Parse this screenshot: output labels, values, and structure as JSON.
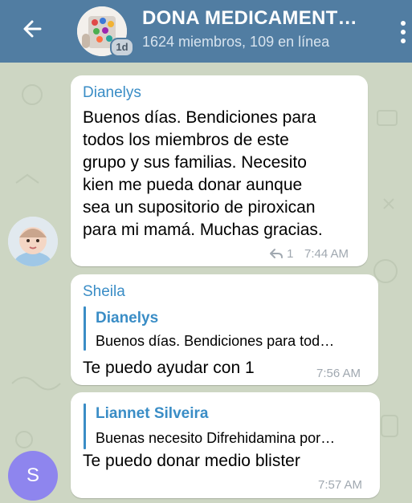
{
  "header": {
    "title": "DONA MEDICAMENT…",
    "subtitle": "1624 miembros, 109 en línea",
    "badge": "1d"
  },
  "messages": [
    {
      "sender": "Dianelys",
      "lines": [
        "Buenos días. Bendiciones para",
        "todos los miembros de este",
        "grupo y sus familias. Necesito",
        "kien me pueda donar aunque",
        "sea un supositorio de piroxican",
        "para mi mamá. Muchas gracias."
      ],
      "reply_count": "1",
      "time": "7:44 AM"
    },
    {
      "sender": "Sheila",
      "reply_to": {
        "name": "Dianelys",
        "text": "Buenos días. Bendiciones para tod…"
      },
      "text": "Te puedo ayudar con 1",
      "time": "7:56 AM"
    },
    {
      "reply_to": {
        "name": "Liannet Silveira",
        "text": "Buenas necesito Difrehidamina por…"
      },
      "text": "Te puedo donar medio blister",
      "time": "7:57 AM",
      "avatar_letter": "S"
    }
  ],
  "colors": {
    "header": "#517da2",
    "accent": "#3a8dc6",
    "chat_background": "#cdd6c3",
    "letter_avatar": "#8e85ee"
  }
}
